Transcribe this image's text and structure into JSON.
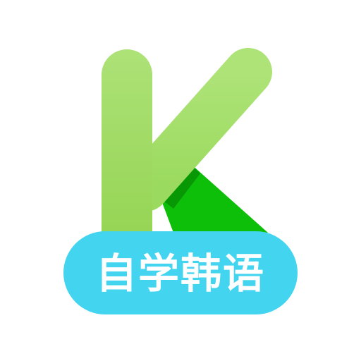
{
  "app": {
    "logo_letter": "K",
    "badge_label": "自学韩语"
  },
  "colors": {
    "stem_top": "#ADE277",
    "stem_bottom": "#92D350",
    "leg": "#0EBF0A",
    "leg_shadow": "#089806",
    "badge": "#43D5EF",
    "badge_text": "#FFFFFF",
    "background": "#FFFFFF"
  }
}
